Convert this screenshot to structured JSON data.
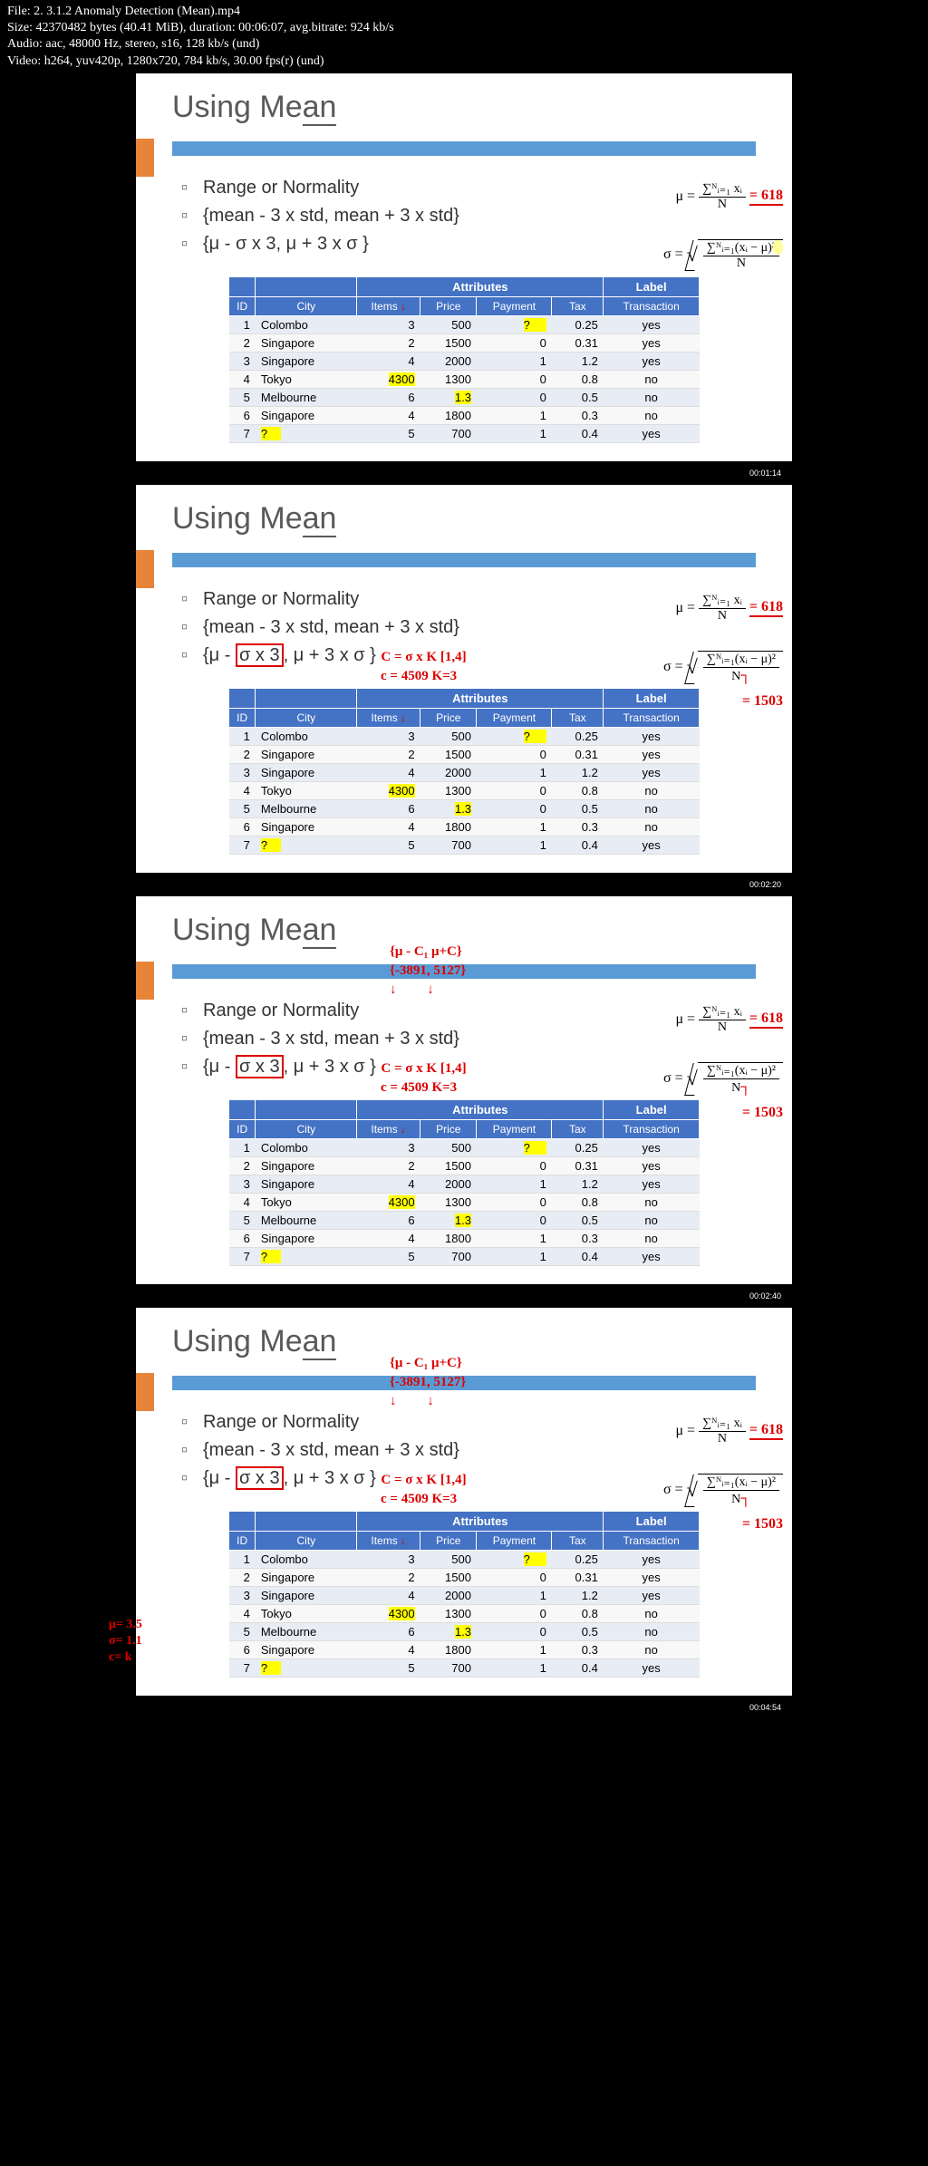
{
  "meta": {
    "l1": "File: 2. 3.1.2 Anomaly Detection (Mean).mp4",
    "l2": "Size: 42370482 bytes (40.41 MiB), duration: 00:06:07, avg.bitrate: 924 kb/s",
    "l3": "Audio: aac, 48000 Hz, stereo, s16, 128 kb/s (und)",
    "l4": "Video: h264, yuv420p, 1280x720, 784 kb/s, 30.00 fps(r) (und)"
  },
  "slide": {
    "title": "Using Mean",
    "bullets": [
      "Range or Normality",
      "{mean - 3 x std, mean + 3 x std}",
      "{μ - σ x 3, μ + 3 x σ }"
    ],
    "mu_eq": "μ =",
    "mu_top": "∑ᴺᵢ₌₁ xᵢ",
    "mu_bot": "N",
    "mu_val": "= 618",
    "sigma_eq": "σ =",
    "sigma_top": "∑ᴺᵢ₌₁(xᵢ − μ)²",
    "sigma_bot": "N",
    "extra": {
      "c1": "C = σ x K   [1,4]",
      "c2": "c = 4509   K=3",
      "res": "= 1503",
      "range": "{μ - C₁  μ+C}",
      "range2": "{-3891,  5127}",
      "mu35": "μ= 3.5",
      "sig11": "σ= 1.1",
      "ck": "c= k"
    }
  },
  "table": {
    "h1": [
      "",
      "",
      "Attributes",
      "",
      "",
      "",
      "Label"
    ],
    "h2": [
      "ID",
      "City",
      "Items",
      "Price",
      "Payment",
      "Tax",
      "Transaction"
    ],
    "rows": [
      [
        "1",
        "Colombo",
        "3",
        "500",
        "?",
        "0.25",
        "yes"
      ],
      [
        "2",
        "Singapore",
        "2",
        "1500",
        "0",
        "0.31",
        "yes"
      ],
      [
        "3",
        "Singapore",
        "4",
        "2000",
        "1",
        "1.2",
        "yes"
      ],
      [
        "4",
        "Tokyo",
        "4300",
        "1300",
        "0",
        "0.8",
        "no"
      ],
      [
        "5",
        "Melbourne",
        "6",
        "1.3",
        "0",
        "0.5",
        "no"
      ],
      [
        "6",
        "Singapore",
        "4",
        "1800",
        "1",
        "0.3",
        "no"
      ],
      [
        "7",
        "?",
        "5",
        "700",
        "1",
        "0.4",
        "yes"
      ]
    ]
  },
  "timestamps": [
    "00:01:14",
    "00:02:20",
    "00:02:40",
    "00:04:54"
  ]
}
